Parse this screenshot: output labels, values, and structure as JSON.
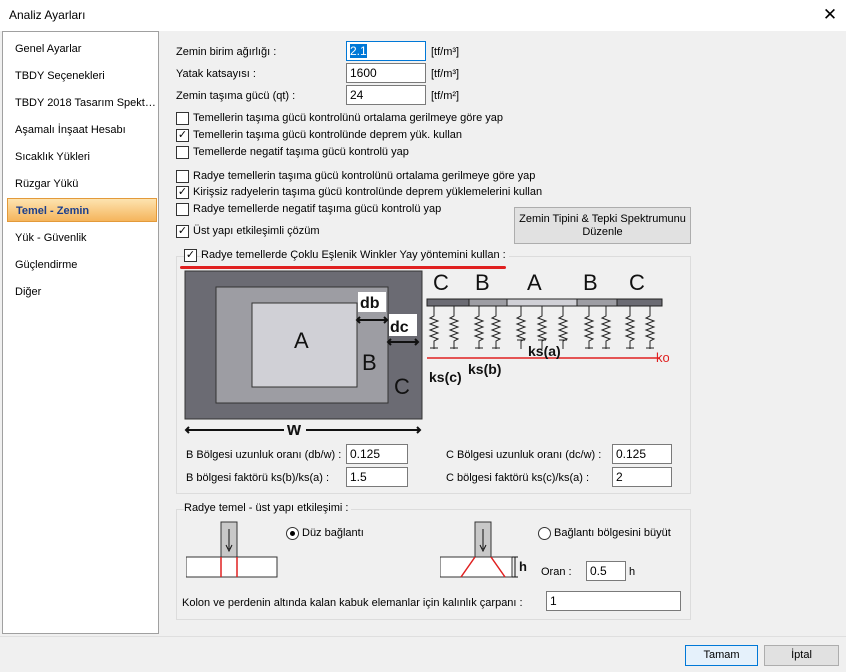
{
  "window": {
    "title": "Analiz Ayarları",
    "close_glyph": "✕"
  },
  "sidebar": {
    "items": [
      {
        "label": "Genel Ayarlar"
      },
      {
        "label": "TBDY Seçenekleri"
      },
      {
        "label": "TBDY 2018 Tasarım Spekt…"
      },
      {
        "label": "Aşamalı İnşaat Hesabı"
      },
      {
        "label": "Sıcaklık Yükleri"
      },
      {
        "label": "Rüzgar Yükü"
      },
      {
        "label": "Temel - Zemin",
        "selected": true
      },
      {
        "label": "Yük - Güvenlik"
      },
      {
        "label": "Güçlendirme"
      },
      {
        "label": "Diğer"
      }
    ]
  },
  "soil": {
    "unit_weight_label": "Zemin birim ağırlığı :",
    "unit_weight_value": "2.1",
    "unit_weight_unit": "[tf/m³]",
    "spring_label": "Yatak katsayısı :",
    "spring_value": "1600",
    "spring_unit": "[tf/m³]",
    "bearing_label": "Zemin taşıma gücü (qt) :",
    "bearing_value": "24",
    "bearing_unit": "[tf/m²]"
  },
  "checks": {
    "c1": {
      "label": "Temellerin taşıma gücü kontrolünü ortalama gerilmeye göre yap",
      "checked": false
    },
    "c2": {
      "label": "Temellerin taşıma gücü kontrolünde deprem yük. kullan",
      "checked": true
    },
    "c3": {
      "label": "Temellerde negatif taşıma gücü kontrolü yap",
      "checked": false
    },
    "c4": {
      "label": "Radye temellerin taşıma gücü kontrolünü ortalama gerilmeye göre yap",
      "checked": false
    },
    "c5": {
      "label": "Kirişsiz radyelerin taşıma gücü kontrolünde deprem yüklemelerini kullan",
      "checked": true
    },
    "c6": {
      "label": "Radye temellerde negatif taşıma gücü kontrolü yap",
      "checked": false
    },
    "c7": {
      "label": "Üst yapı etkileşimli çözüm",
      "checked": true
    },
    "c8": {
      "label": "Radye temellerde Çoklu Eşlenik Winkler Yay yöntemini kullan :",
      "checked": true
    }
  },
  "spectrum_button": {
    "line1": "Zemin Tipini  & Tepki Spektrumunu",
    "line2": "Düzenle"
  },
  "diagram": {
    "zone_a": "A",
    "zone_b": "B",
    "zone_c": "C",
    "db": "db",
    "dc": "dc",
    "w": "w",
    "ks_c": "ks(c)",
    "ks_b": "ks(b)",
    "ks_a": "ks(a)",
    "ko": "ko",
    "top_labels": [
      "C",
      "B",
      "A",
      "B",
      "C"
    ]
  },
  "ratios": {
    "b_len_label": "B Bölgesi uzunluk oranı (db/w) :",
    "b_len_value": "0.125",
    "c_len_label": "C Bölgesi uzunluk oranı (dc/w) :",
    "c_len_value": "0.125",
    "b_fac_label": "B bölgesi faktörü ks(b)/ks(a) :",
    "b_fac_value": "1.5",
    "c_fac_label": "C bölgesi faktörü ks(c)/ks(a) :",
    "c_fac_value": "2"
  },
  "interaction": {
    "group_label": "Radye temel - üst yapı etkileşimi :",
    "opt1_label": "Düz bağlantı",
    "opt1_selected": true,
    "opt2_label": "Bağlantı bölgesini büyüt",
    "opt2_selected": false,
    "h_glyph": "h",
    "ratio_label": "Oran :",
    "ratio_value": "0.5",
    "ratio_unit": "h",
    "thickness_label": "Kolon ve perdenin altında kalan kabuk elemanlar için kalınlık çarpanı :",
    "thickness_value": "1"
  },
  "footer": {
    "ok_label": "Tamam",
    "cancel_label": "İptal"
  },
  "colors": {
    "selection": "#f5b55c",
    "accent_red": "#e02020",
    "focus_blue": "#0078d7"
  }
}
